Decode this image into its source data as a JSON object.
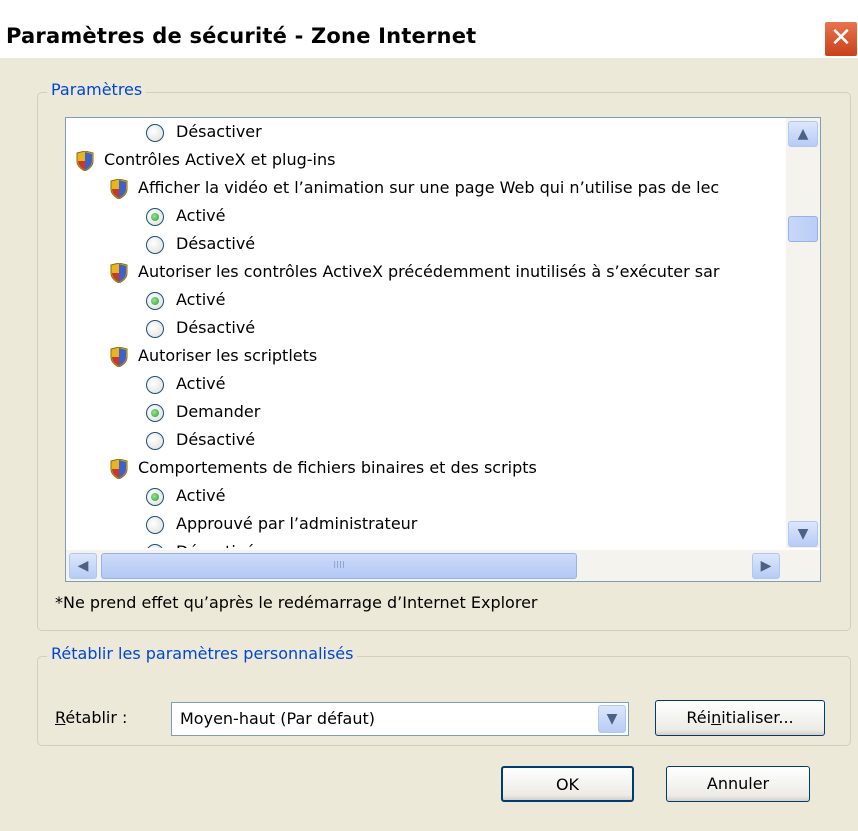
{
  "window": {
    "title": "Paramètres de sécurité - Zone Internet",
    "close_symbol": "✕"
  },
  "settings_group": {
    "legend": "Paramètres",
    "rows": [
      {
        "type": "radio",
        "level": 2,
        "checked": false,
        "label": "Désactiver"
      },
      {
        "type": "category",
        "level": 0,
        "icon": "shield-icon",
        "label": "Contrôles ActiveX et plug-ins"
      },
      {
        "type": "setting",
        "level": 1,
        "icon": "shield-icon",
        "label": "Afficher la vidéo et l’animation sur une page Web qui n’utilise pas de lec"
      },
      {
        "type": "radio",
        "level": 2,
        "checked": true,
        "label": "Activé"
      },
      {
        "type": "radio",
        "level": 2,
        "checked": false,
        "label": "Désactivé"
      },
      {
        "type": "setting",
        "level": 1,
        "icon": "shield-icon",
        "label": "Autoriser les contrôles ActiveX précédemment inutilisés à s’exécuter sar"
      },
      {
        "type": "radio",
        "level": 2,
        "checked": true,
        "label": "Activé"
      },
      {
        "type": "radio",
        "level": 2,
        "checked": false,
        "label": "Désactivé"
      },
      {
        "type": "setting",
        "level": 1,
        "icon": "shield-icon",
        "label": "Autoriser les scriptlets"
      },
      {
        "type": "radio",
        "level": 2,
        "checked": false,
        "label": "Activé"
      },
      {
        "type": "radio",
        "level": 2,
        "checked": true,
        "label": "Demander"
      },
      {
        "type": "radio",
        "level": 2,
        "checked": false,
        "label": "Désactivé"
      },
      {
        "type": "setting",
        "level": 1,
        "icon": "shield-icon",
        "label": "Comportements de fichiers binaires et des scripts"
      },
      {
        "type": "radio",
        "level": 2,
        "checked": true,
        "label": "Activé"
      },
      {
        "type": "radio",
        "level": 2,
        "checked": false,
        "label": "Approuvé par l’administrateur"
      },
      {
        "type": "radio",
        "level": 2,
        "checked": false,
        "label": "Désactivé"
      }
    ],
    "scroll_up_symbol": "▲",
    "scroll_down_symbol": "▼",
    "scroll_left_symbol": "◀",
    "scroll_right_symbol": "▶",
    "thumb_grip": "IIII",
    "note": "*Ne prend effet qu’après le redémarrage d’Internet Explorer"
  },
  "reset_group": {
    "legend": "Rétablir les paramètres personnalisés",
    "label_prefix": "R",
    "label_rest": "établir :",
    "combo_value": "Moyen-haut (Par défaut)",
    "combo_arrow": "▼",
    "reset_button_pre": "Réi",
    "reset_button_u": "n",
    "reset_button_post": "itialiser..."
  },
  "footer": {
    "ok_label": "OK",
    "cancel_label": "Annuler"
  },
  "colors": {
    "dialog_bg": "#ECE9D8",
    "legend_blue": "#0046D5",
    "close_red": "#C8421A"
  }
}
